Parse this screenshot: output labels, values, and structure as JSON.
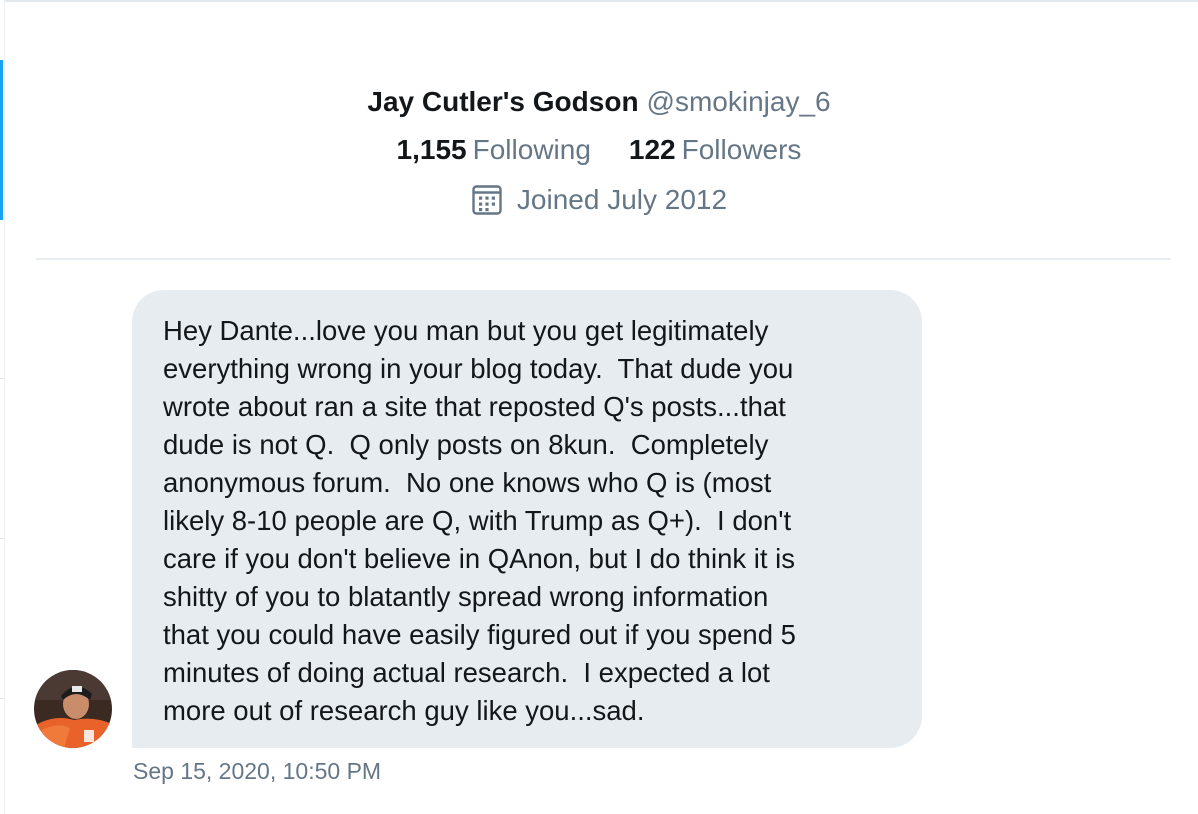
{
  "profile": {
    "display_name": "Jay Cutler's Godson",
    "handle": "@smokinjay_6",
    "following_count": "1,155",
    "following_label": "Following",
    "followers_count": "122",
    "followers_label": "Followers",
    "joined_icon": "calendar-icon",
    "joined_text": "Joined July 2012"
  },
  "message": {
    "text": "Hey Dante...love you man but you get legitimately\neverything wrong in your blog today.  That dude you\nwrote about ran a site that reposted Q's posts...that\ndude is not Q.  Q only posts on 8kun.  Completely\nanonymous forum.  No one knows who Q is (most\nlikely 8-10 people are Q, with Trump as Q+).  I don't\ncare if you don't believe in QAnon, but I do think it is\nshitty of you to blatantly spread wrong information\nthat you could have easily figured out if you spend 5\nminutes of doing actual research.  I expected a lot\nmore out of research guy like you...sad.",
    "timestamp": "Sep 15, 2020, 10:50 PM",
    "bubble_color": "#e6ecf0"
  },
  "colors": {
    "accent": "#1da1f2",
    "text_primary": "#14171a",
    "text_secondary": "#657786"
  }
}
